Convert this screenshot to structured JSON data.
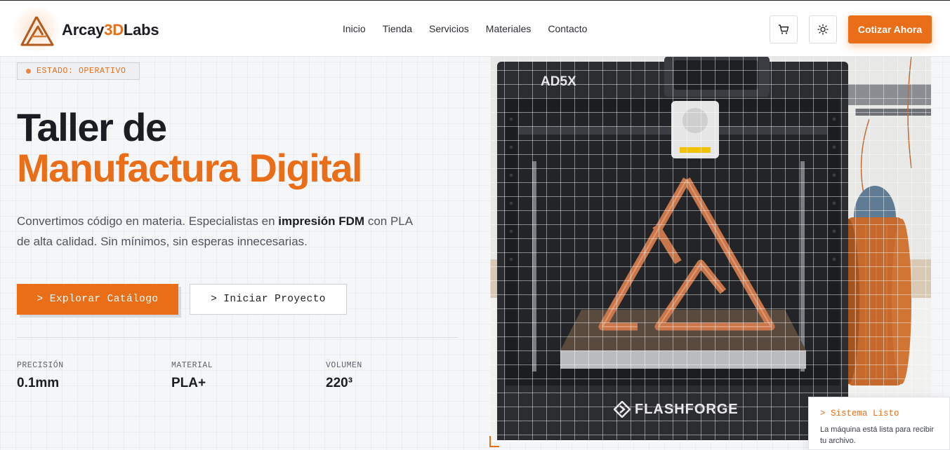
{
  "brand": {
    "name_prefix": "Arcay",
    "name_accent": "3D",
    "name_suffix": "Labs",
    "logo_icon": "triangle-logo-icon",
    "accent_color": "#ea6d17"
  },
  "nav": {
    "items": [
      {
        "label": "Inicio"
      },
      {
        "label": "Tienda"
      },
      {
        "label": "Servicios"
      },
      {
        "label": "Materiales"
      },
      {
        "label": "Contacto"
      }
    ]
  },
  "header": {
    "cart_icon": "cart-icon",
    "theme_icon": "sun-icon",
    "cta_label": "Cotizar Ahora"
  },
  "hero": {
    "status": "ESTADO: OPERATIVO",
    "title_line1": "Taller de",
    "title_line2": "Manufactura Digital",
    "desc_part1": "Convertimos código en materia. Especialistas en ",
    "desc_bold": "impresión FDM",
    "desc_part2": " con PLA de alta calidad. Sin mínimos, sin esperas innecesarias.",
    "primary_button": "> Explorar Catálogo",
    "secondary_button": "> Iniciar Proyecto"
  },
  "stats": [
    {
      "label": "PRECISIÓN",
      "value": "0.1mm"
    },
    {
      "label": "MATERIAL",
      "value": "PLA+"
    },
    {
      "label": "VOLUMEN",
      "value": "220³"
    }
  ],
  "printer": {
    "model_label": "AD5X",
    "brand_label": "FLASHFORGE"
  },
  "toast": {
    "title": "> Sistema Listo",
    "body": "La máquina está lista para recibir tu archivo."
  }
}
